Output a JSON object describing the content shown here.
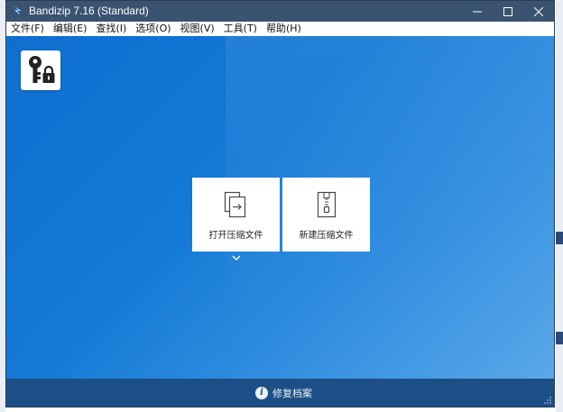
{
  "window": {
    "title": "Bandizip 7.16 (Standard)"
  },
  "menubar": {
    "items": [
      {
        "label": "文件(F)"
      },
      {
        "label": "编辑(E)"
      },
      {
        "label": "查找(I)"
      },
      {
        "label": "选项(O)"
      },
      {
        "label": "视图(V)"
      },
      {
        "label": "工具(T)"
      },
      {
        "label": "帮助(H)"
      }
    ]
  },
  "main": {
    "password_tool_icon": "key-lock-icon",
    "actions": [
      {
        "label": "打开压缩文件",
        "icon": "open-archive-icon"
      },
      {
        "label": "新建压缩文件",
        "icon": "new-archive-icon"
      }
    ],
    "more_icon": "chevron-down-icon"
  },
  "footer": {
    "repair_label": "修复档案",
    "repair_icon": "info-icon"
  },
  "colors": {
    "titlebar": "#3a5371",
    "main_gradient_start": "#0f6fd0",
    "main_gradient_end": "#5aa8e8",
    "footer": "#1c4f86"
  }
}
